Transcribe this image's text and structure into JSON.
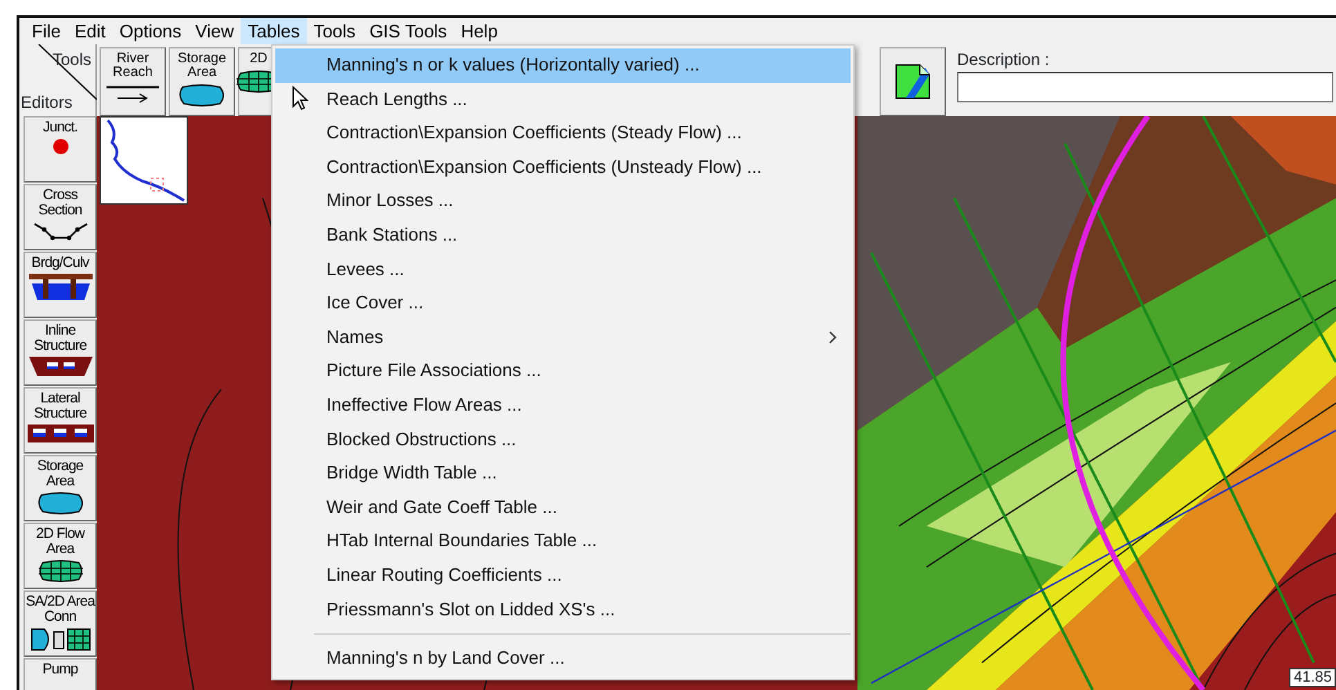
{
  "menu_bar": [
    {
      "label": "File",
      "selected": false
    },
    {
      "label": "Edit",
      "selected": false
    },
    {
      "label": "Options",
      "selected": false
    },
    {
      "label": "View",
      "selected": false
    },
    {
      "label": "Tables",
      "selected": true
    },
    {
      "label": "Tools",
      "selected": false
    },
    {
      "label": "GIS Tools",
      "selected": false
    },
    {
      "label": "Help",
      "selected": false
    }
  ],
  "toolbar": {
    "corner": {
      "top": "Tools",
      "bottom": "Editors"
    },
    "buttons": [
      {
        "kind": "river",
        "lines": [
          "River",
          "Reach"
        ]
      },
      {
        "kind": "storage",
        "lines": [
          "Storage",
          "Area"
        ]
      },
      {
        "kind": "flow_area",
        "lines": [
          "2D"
        ]
      }
    ],
    "description": {
      "label": "Description :"
    }
  },
  "editors": [
    {
      "kind": "junction",
      "lines": [
        "Junct."
      ]
    },
    {
      "kind": "cross_section",
      "lines": [
        "Cross",
        "Section"
      ]
    },
    {
      "kind": "bridge",
      "lines": [
        "Brdg/Culv"
      ]
    },
    {
      "kind": "inline",
      "lines": [
        "Inline",
        "Structure"
      ]
    },
    {
      "kind": "lateral",
      "lines": [
        "Lateral",
        "Structure"
      ]
    },
    {
      "kind": "storage",
      "lines": [
        "Storage",
        "Area"
      ]
    },
    {
      "kind": "flow_area",
      "lines": [
        "2D Flow",
        "Area"
      ]
    },
    {
      "kind": "connection",
      "lines": [
        "SA/2D Area",
        "Conn"
      ]
    },
    {
      "kind": "pump",
      "lines": [
        "Pump"
      ]
    }
  ],
  "map": {
    "station_label": "41.85"
  },
  "tables_menu": [
    {
      "kind": "item",
      "label": "Manning's n or k values (Horizontally varied) ...",
      "selected": true
    },
    {
      "kind": "item",
      "label": "Reach Lengths ...",
      "selected": false
    },
    {
      "kind": "item",
      "label": "Contraction\\Expansion Coefficients (Steady Flow) ...",
      "selected": false
    },
    {
      "kind": "item",
      "label": "Contraction\\Expansion Coefficients (Unsteady Flow) ...",
      "selected": false
    },
    {
      "kind": "item",
      "label": "Minor Losses ...",
      "selected": false
    },
    {
      "kind": "item",
      "label": "Bank Stations ...",
      "selected": false
    },
    {
      "kind": "item",
      "label": "Levees ...",
      "selected": false
    },
    {
      "kind": "item",
      "label": "Ice Cover ...",
      "selected": false
    },
    {
      "kind": "submenu",
      "label": "Names",
      "selected": false
    },
    {
      "kind": "item",
      "label": "Picture File Associations ...",
      "selected": false
    },
    {
      "kind": "item",
      "label": "Ineffective Flow Areas ...",
      "selected": false
    },
    {
      "kind": "item",
      "label": "Blocked Obstructions ...",
      "selected": false
    },
    {
      "kind": "item",
      "label": "Bridge Width Table ...",
      "selected": false
    },
    {
      "kind": "item",
      "label": "Weir and Gate Coeff Table ...",
      "selected": false
    },
    {
      "kind": "item",
      "label": "HTab Internal Boundaries Table ...",
      "selected": false
    },
    {
      "kind": "item",
      "label": "Linear Routing Coefficients ...",
      "selected": false
    },
    {
      "kind": "item",
      "label": "Priessmann's Slot on Lidded XS's ...",
      "selected": false
    },
    {
      "kind": "separator"
    },
    {
      "kind": "item",
      "label": "Manning's n by Land Cover ...",
      "selected": false
    }
  ]
}
